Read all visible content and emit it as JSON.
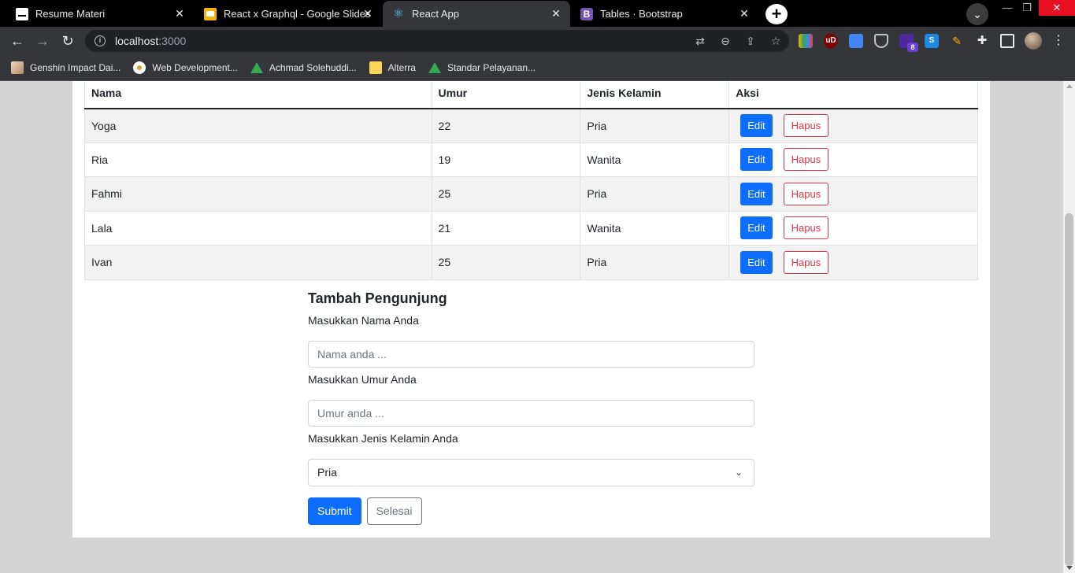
{
  "browser": {
    "tabs": [
      {
        "title": "Resume Materi",
        "icon": "doc-icon",
        "active": false
      },
      {
        "title": "React x Graphql - Google Slides",
        "icon": "slides-icon",
        "active": false
      },
      {
        "title": "React App",
        "icon": "react-icon",
        "active": true
      },
      {
        "title": "Tables · Bootstrap",
        "icon": "bootstrap-icon",
        "active": false
      }
    ],
    "address": {
      "host": "localhost",
      "port": ":3000"
    },
    "bookmarks": [
      {
        "label": "Genshin Impact Dai..."
      },
      {
        "label": "Web Development..."
      },
      {
        "label": "Achmad Solehuddi..."
      },
      {
        "label": "Alterra"
      },
      {
        "label": "Standar Pelayanan..."
      }
    ],
    "extensions_badge": "8"
  },
  "table": {
    "headers": [
      "Nama",
      "Umur",
      "Jenis Kelamin",
      "Aksi"
    ],
    "rows": [
      {
        "nama": "Yoga",
        "umur": "22",
        "jenis_kelamin": "Pria"
      },
      {
        "nama": "Ria",
        "umur": "19",
        "jenis_kelamin": "Wanita"
      },
      {
        "nama": "Fahmi",
        "umur": "25",
        "jenis_kelamin": "Pria"
      },
      {
        "nama": "Lala",
        "umur": "21",
        "jenis_kelamin": "Wanita"
      },
      {
        "nama": "Ivan",
        "umur": "25",
        "jenis_kelamin": "Pria"
      }
    ],
    "edit_label": "Edit",
    "hapus_label": "Hapus"
  },
  "form": {
    "title": "Tambah Pengunjung",
    "nama_label": "Masukkan Nama Anda",
    "nama_placeholder": "Nama anda ...",
    "umur_label": "Masukkan Umur Anda",
    "umur_placeholder": "Umur anda ...",
    "gender_label": "Masukkan Jenis Kelamin Anda",
    "gender_selected": "Pria",
    "submit_label": "Submit",
    "selesai_label": "Selesai"
  },
  "colors": {
    "primary": "#0d6efd",
    "danger": "#dc3545",
    "secondary": "#6c757d",
    "page_bg": "#d4d4d4"
  }
}
